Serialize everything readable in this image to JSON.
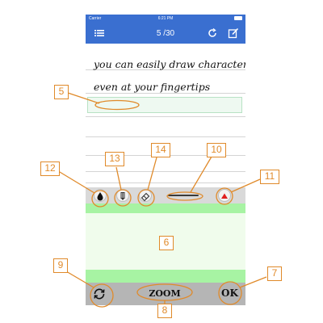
{
  "status_bar": {
    "carrier": "Carrier",
    "time": "6:21 PM"
  },
  "nav_bar": {
    "page_indicator": "5 /30"
  },
  "writing": {
    "line1": "you can easily draw characters",
    "line2": "even at your fingertips"
  },
  "bottom_bar": {
    "zoom_label": "ZOOM",
    "ok_label": "OK"
  },
  "callouts": {
    "c5": "5",
    "c6": "6",
    "c7": "7",
    "c8": "8",
    "c9": "9",
    "c10": "10",
    "c11": "11",
    "c12": "12",
    "c13": "13",
    "c14": "14"
  },
  "colors": {
    "nav_blue": "#3a6fd0",
    "callout_orange": "#e08a2a",
    "zoom_band_green": "#a7f3a3",
    "zoom_area_green": "#f0fcec",
    "scroll_arrow_red": "#e02020"
  },
  "icons": {
    "menu": "menu-icon",
    "refresh": "refresh-icon",
    "edit": "edit-icon",
    "ink_color": "ink-drop-icon",
    "pen": "pen-icon",
    "eraser": "eraser-icon",
    "scroll_up": "triangle-up-icon",
    "rotate": "rotate-icon"
  }
}
